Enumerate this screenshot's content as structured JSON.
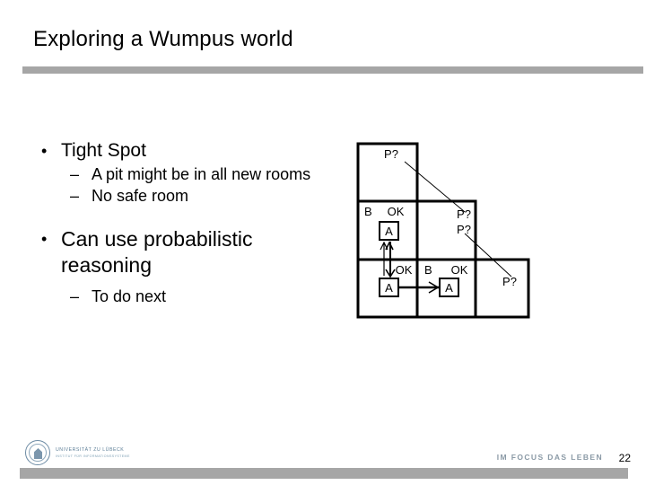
{
  "slide": {
    "title": "Exploring a Wumpus world",
    "page_number": "22"
  },
  "content": {
    "groups": [
      {
        "bullet_mark": "•",
        "heading": "Tight Spot",
        "sub_mark": "–",
        "subitems": [
          "A pit might be in all new rooms",
          "No safe room"
        ]
      },
      {
        "bullet_mark": "•",
        "heading": "Can use probabilistic reasoning",
        "sub_mark": "–",
        "subitems": [
          "To do next"
        ]
      }
    ]
  },
  "diagram": {
    "title": "wumpus-world-grid",
    "labels": {
      "pit_maybe": "P?",
      "breeze": "B",
      "safe": "OK",
      "agent": "A"
    },
    "cells": [
      {
        "id": "r0c0",
        "row": 0,
        "col": 0,
        "marks": [
          "P?"
        ]
      },
      {
        "id": "r1c0",
        "row": 1,
        "col": 0,
        "marks": [
          "B",
          "OK",
          "A"
        ]
      },
      {
        "id": "r1c1",
        "row": 1,
        "col": 1,
        "marks": [
          "P?",
          "P?"
        ]
      },
      {
        "id": "r2c0",
        "row": 2,
        "col": 0,
        "marks": [
          "OK",
          "A"
        ]
      },
      {
        "id": "r2c1",
        "row": 2,
        "col": 1,
        "marks": [
          "B",
          "OK",
          "A"
        ]
      },
      {
        "id": "r2c2",
        "row": 2,
        "col": 2,
        "marks": [
          "P?"
        ]
      }
    ],
    "arrows": [
      {
        "id": "agent-vertical",
        "kind": "double-headed",
        "from": "r2c0",
        "to": "r1c0"
      },
      {
        "id": "agent-horizontal",
        "kind": "single-headed",
        "from": "r2c0",
        "to": "r2c1"
      }
    ],
    "connectors": [
      {
        "id": "pit-link-top",
        "from": "P? (r0c0)",
        "to": "P? (r1c1)"
      },
      {
        "id": "pit-link-bottom",
        "from": "P? (r1c1)",
        "to": "P? (r2c2)"
      }
    ]
  },
  "footer": {
    "logo_line1": "UNIVERSITÄT ZU LÜBECK",
    "logo_line2": "INSTITUT FÜR INFORMATIONSSYSTEME",
    "tagline": "IM FOCUS DAS LEBEN"
  },
  "colors": {
    "rule": "#a6a6a6",
    "text": "#000000",
    "logo": "#5b7d96",
    "tagline": "#8b9aa6"
  }
}
